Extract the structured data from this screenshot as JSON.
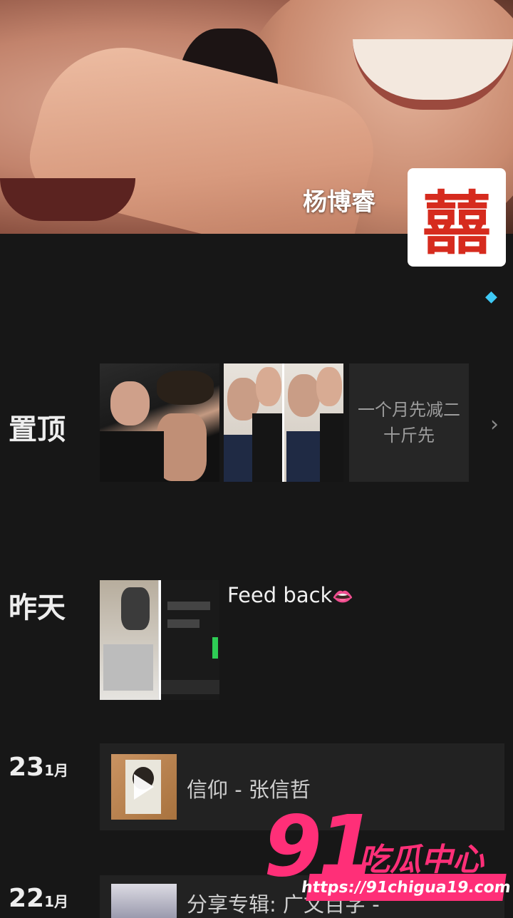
{
  "profile": {
    "name": "杨博睿",
    "badge_char": "囍"
  },
  "vip_icon": "diamond-icon",
  "sections": {
    "pinned": {
      "label": "置顶",
      "text_post": "一个月先减二十斤先"
    },
    "yesterday": {
      "label": "昨天",
      "post_title": "Feed back",
      "post_emoji": "👄"
    },
    "jan23": {
      "day": "23",
      "month": "1月",
      "music_title": "信仰 - 张信哲"
    },
    "jan22": {
      "day": "22",
      "month": "1月",
      "album_title": "分享专辑: 广文百字 -"
    }
  },
  "watermark": {
    "number": "91",
    "text": "吃瓜中心",
    "url": "https://91chigua19.com"
  },
  "colors": {
    "background": "#171717",
    "card": "#222222",
    "accent_watermark": "#ff2f78",
    "badge_red": "#d62b1e"
  }
}
